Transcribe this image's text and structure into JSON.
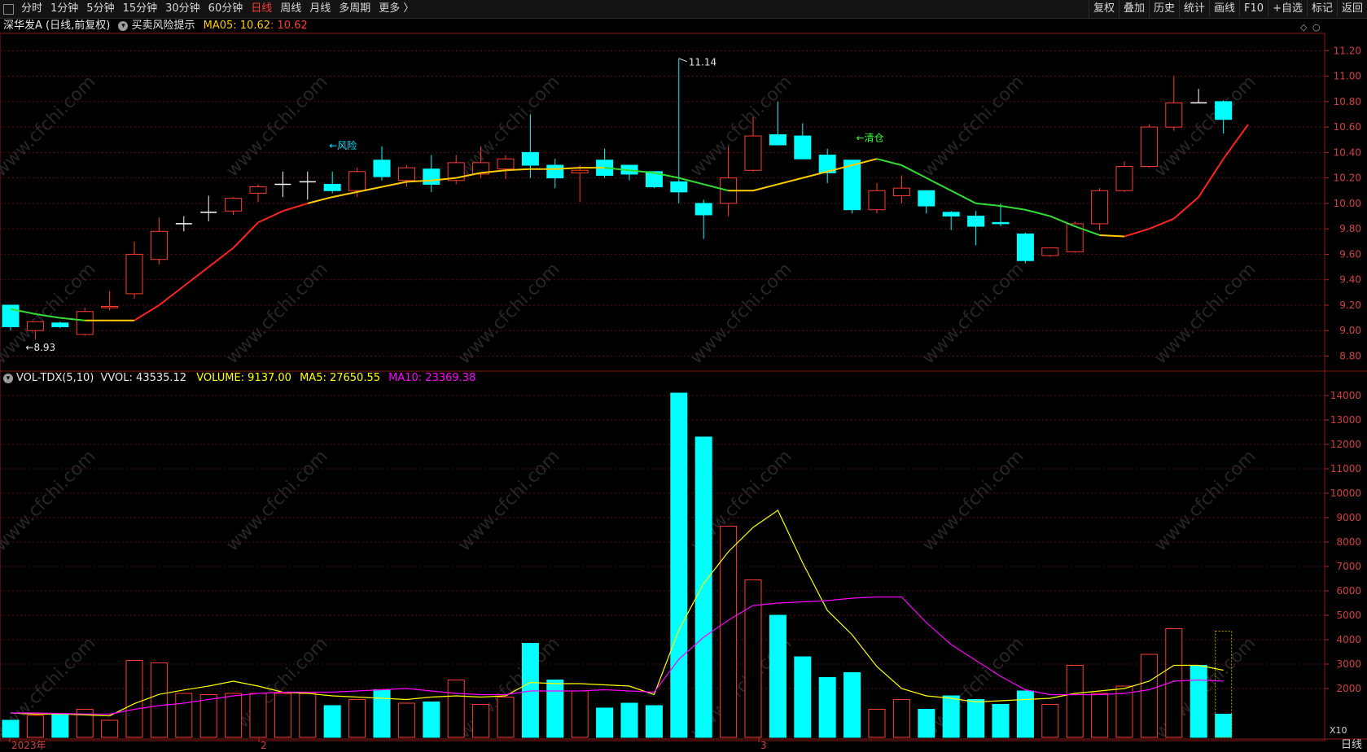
{
  "toolbar": {
    "periods": [
      "分时",
      "1分钟",
      "5分钟",
      "15分钟",
      "30分钟",
      "60分钟",
      "日线",
      "周线",
      "月线",
      "多周期",
      "更多 〉"
    ],
    "active_period": "日线",
    "right_buttons": [
      "复权",
      "叠加",
      "历史",
      "统计",
      "画线",
      "F10",
      "+自选",
      "标记",
      "返回"
    ]
  },
  "main_legend": {
    "stock": "深华发A",
    "mode": "(日线,前复权)",
    "indicator": "买卖风险提示",
    "ma_label": "MA05: 10.62",
    "ma_value": ": 10.62"
  },
  "vol_legend": {
    "name": "VOL-TDX(5,10)",
    "vvol": "VVOL: 43535.12",
    "volume": "VOLUME: 9137.00",
    "ma5": "MA5: 27650.55",
    "ma10": "MA10: 23369.38"
  },
  "annotations": {
    "low": "←8.93",
    "high": "11.14",
    "risk": "←风险",
    "clear": "←清仓",
    "x10": "X10"
  },
  "x_axis_labels": [
    "2023年",
    "2",
    "3"
  ],
  "bottom_right_label": "日线",
  "colors": {
    "up": "#ff3b30",
    "down": "#00ffff",
    "ma5": "#ffff00",
    "ma10": "#ff00ff",
    "risk_text": "#00e5ff",
    "clear_text": "#33ff33"
  },
  "chart_data": [
    {
      "type": "candlestick",
      "title": "深华发A (日线,前复权)",
      "y_ticks": [
        8.8,
        9.0,
        9.2,
        9.4,
        9.6,
        9.8,
        10.0,
        10.2,
        10.4,
        10.6,
        10.8,
        11.0,
        11.2
      ],
      "ylim": [
        8.72,
        11.33
      ],
      "ohlc": [
        [
          9.2,
          9.2,
          9.0,
          9.03
        ],
        [
          9.0,
          9.07,
          8.93,
          9.07
        ],
        [
          9.06,
          9.07,
          9.02,
          9.03
        ],
        [
          8.97,
          9.18,
          8.96,
          9.15
        ],
        [
          9.18,
          9.31,
          9.16,
          9.19
        ],
        [
          9.29,
          9.7,
          9.25,
          9.6
        ],
        [
          9.56,
          9.89,
          9.52,
          9.78
        ],
        [
          9.84,
          9.9,
          9.78,
          9.84
        ],
        [
          9.93,
          10.06,
          9.86,
          9.93
        ],
        [
          9.94,
          10.05,
          9.91,
          10.04
        ],
        [
          10.08,
          10.15,
          10.01,
          10.13
        ],
        [
          10.15,
          10.25,
          10.05,
          10.15
        ],
        [
          10.17,
          10.25,
          10.03,
          10.17
        ],
        [
          10.15,
          10.25,
          10.08,
          10.1
        ],
        [
          10.1,
          10.28,
          10.05,
          10.25
        ],
        [
          10.34,
          10.45,
          10.18,
          10.21
        ],
        [
          10.18,
          10.3,
          10.13,
          10.28
        ],
        [
          10.27,
          10.38,
          10.09,
          10.15
        ],
        [
          10.18,
          10.38,
          10.15,
          10.32
        ],
        [
          10.23,
          10.45,
          10.2,
          10.32
        ],
        [
          10.27,
          10.38,
          10.19,
          10.35
        ],
        [
          10.4,
          10.7,
          10.2,
          10.3
        ],
        [
          10.3,
          10.35,
          10.12,
          10.2
        ],
        [
          10.24,
          10.3,
          10.01,
          10.26
        ],
        [
          10.34,
          10.43,
          10.2,
          10.22
        ],
        [
          10.3,
          10.3,
          10.18,
          10.23
        ],
        [
          10.25,
          10.25,
          10.12,
          10.13
        ],
        [
          10.17,
          11.14,
          10.0,
          10.09
        ],
        [
          10.0,
          10.03,
          9.72,
          9.91
        ],
        [
          10.0,
          10.45,
          9.9,
          10.2
        ],
        [
          10.26,
          10.68,
          10.25,
          10.53
        ],
        [
          10.54,
          10.8,
          10.46,
          10.46
        ],
        [
          10.53,
          10.63,
          10.35,
          10.35
        ],
        [
          10.38,
          10.43,
          10.16,
          10.24
        ],
        [
          10.34,
          10.34,
          9.92,
          9.95
        ],
        [
          9.95,
          10.16,
          9.92,
          10.1
        ],
        [
          10.06,
          10.22,
          10.0,
          10.12
        ],
        [
          10.1,
          10.1,
          9.92,
          9.98
        ],
        [
          9.93,
          9.94,
          9.79,
          9.9
        ],
        [
          9.9,
          9.94,
          9.67,
          9.82
        ],
        [
          9.85,
          10.0,
          9.82,
          9.84
        ],
        [
          9.76,
          9.77,
          9.53,
          9.55
        ],
        [
          9.59,
          9.65,
          9.58,
          9.65
        ],
        [
          9.62,
          9.86,
          9.61,
          9.84
        ],
        [
          9.84,
          10.12,
          9.79,
          10.1
        ],
        [
          10.1,
          10.33,
          10.09,
          10.29
        ],
        [
          10.29,
          10.62,
          10.28,
          10.6
        ],
        [
          10.6,
          11.0,
          10.57,
          10.79
        ],
        [
          10.79,
          10.9,
          10.79,
          10.79
        ],
        [
          10.8,
          10.81,
          10.55,
          10.66
        ]
      ],
      "ma5": [
        9.17,
        9.13,
        9.1,
        9.08,
        9.08,
        9.08,
        9.2,
        9.35,
        9.5,
        9.65,
        9.85,
        9.94,
        10.0,
        10.05,
        10.09,
        10.13,
        10.17,
        10.18,
        10.2,
        10.24,
        10.26,
        10.27,
        10.27,
        10.28,
        10.28,
        10.26,
        10.24,
        10.2,
        10.15,
        10.1,
        10.1,
        10.15,
        10.2,
        10.25,
        10.3,
        10.35,
        10.3,
        10.2,
        10.1,
        10.0,
        9.98,
        9.95,
        9.9,
        9.82,
        9.75,
        9.74,
        9.8,
        9.88,
        10.05,
        10.35,
        10.62
      ],
      "annotations": {
        "high": 11.14,
        "low": 8.93,
        "risk_at_index": 13,
        "clear_at_index": 34
      }
    },
    {
      "type": "bar",
      "title": "VOL-TDX(5,10)",
      "y_ticks": [
        2000,
        3000,
        4000,
        5000,
        6000,
        7000,
        8000,
        9000,
        10000,
        11000,
        12000,
        13000,
        14000
      ],
      "ylim": [
        0,
        14400
      ],
      "unit": "X10",
      "values": [
        700,
        900,
        950,
        1150,
        700,
        3150,
        3050,
        1800,
        1750,
        1800,
        1800,
        1800,
        1800,
        1300,
        1550,
        1950,
        1400,
        1450,
        2350,
        1350,
        1650,
        3850,
        2350,
        1900,
        1200,
        1400,
        1300,
        14100,
        12300,
        8650,
        6450,
        5000,
        3300,
        2450,
        2650,
        1150,
        1550,
        1150,
        1700,
        1550,
        1350,
        1900,
        1350,
        2950,
        1800,
        2100,
        3400,
        4450,
        2950,
        950
      ],
      "up": [
        false,
        true,
        false,
        true,
        true,
        true,
        true,
        true,
        true,
        true,
        true,
        true,
        true,
        false,
        true,
        false,
        true,
        false,
        true,
        true,
        true,
        false,
        false,
        true,
        false,
        false,
        false,
        false,
        false,
        true,
        true,
        false,
        false,
        false,
        false,
        true,
        true,
        false,
        false,
        false,
        false,
        false,
        true,
        true,
        true,
        true,
        true,
        true,
        false,
        false
      ],
      "ma5": [
        1000,
        950,
        960,
        920,
        880,
        1380,
        1760,
        1940,
        2100,
        2300,
        2100,
        1850,
        1800,
        1700,
        1650,
        1600,
        1550,
        1650,
        1700,
        1650,
        1700,
        2250,
        2200,
        2200,
        2150,
        2100,
        1750,
        4400,
        6300,
        7600,
        8600,
        9300,
        7150,
        5200,
        4200,
        2900,
        2000,
        1700,
        1600,
        1450,
        1500,
        1550,
        1600,
        1800,
        1900,
        2000,
        2300,
        2950,
        2950,
        2750
      ],
      "ma10": [
        1000,
        1000,
        980,
        960,
        950,
        1150,
        1300,
        1400,
        1550,
        1700,
        1800,
        1850,
        1850,
        1850,
        1900,
        1950,
        2000,
        1900,
        1800,
        1750,
        1750,
        1900,
        1900,
        1900,
        1950,
        1900,
        1850,
        3200,
        4100,
        4800,
        5400,
        5500,
        5550,
        5600,
        5700,
        5750,
        5750,
        4700,
        3800,
        3150,
        2500,
        1950,
        1750,
        1750,
        1750,
        1800,
        1950,
        2300,
        2350,
        2300
      ]
    }
  ]
}
